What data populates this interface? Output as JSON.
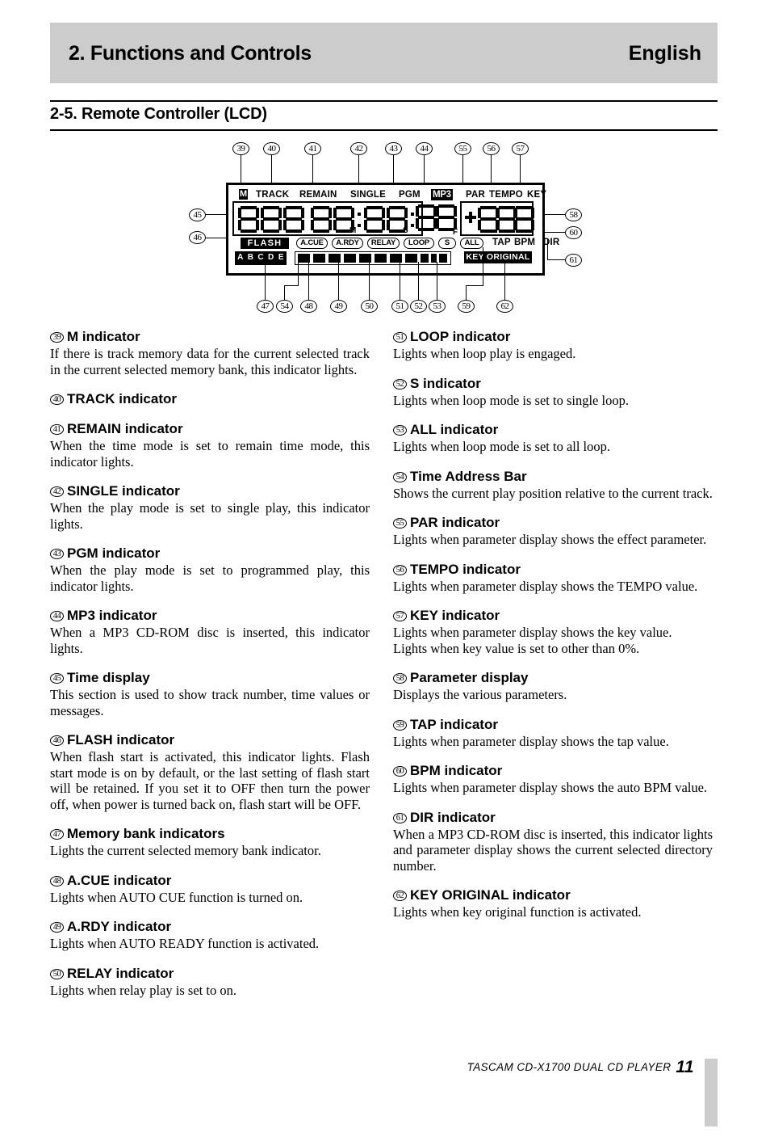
{
  "header": {
    "title": "2. Functions and Controls",
    "language": "English"
  },
  "section": {
    "title": "2-5. Remote Controller (LCD)"
  },
  "figure": {
    "callouts_top": [
      "39",
      "40",
      "41",
      "42",
      "43",
      "44",
      "55",
      "56",
      "57"
    ],
    "callouts_left": [
      "45",
      "46"
    ],
    "callouts_right": [
      "58",
      "60",
      "61"
    ],
    "callouts_bottom": [
      "47",
      "54",
      "48",
      "49",
      "50",
      "51",
      "52",
      "53",
      "59",
      "62"
    ],
    "lcd": {
      "top_indicators": [
        "M",
        "TRACK",
        "REMAIN",
        "SINGLE",
        "PGM",
        "MP3",
        "PAR",
        "TEMPO",
        "KEY"
      ],
      "time_units": [
        "M",
        "S",
        "F"
      ],
      "flash": "FLASH",
      "pills": [
        "A.CUE",
        "A.RDY",
        "RELAY",
        "LOOP",
        "S",
        "ALL"
      ],
      "plain_indicators": [
        "TAP",
        "BPM",
        "DIR"
      ],
      "memory_banks": [
        "A",
        "B",
        "C",
        "D",
        "E"
      ],
      "key_original": "KEY ORIGINAL"
    }
  },
  "left_column": [
    {
      "num": "39",
      "title": "M indicator",
      "body": "If there is track memory data for the current selected track in the current selected memory bank, this indicator lights."
    },
    {
      "num": "40",
      "title": "TRACK indicator",
      "body": ""
    },
    {
      "num": "41",
      "title": "REMAIN indicator",
      "body": "When the time mode is set to remain time mode, this indicator lights."
    },
    {
      "num": "42",
      "title": "SINGLE indicator",
      "body": "When the play mode is set to single play, this indicator lights."
    },
    {
      "num": "43",
      "title": "PGM indicator",
      "body": "When the play mode is set to programmed play, this indicator lights."
    },
    {
      "num": "44",
      "title": "MP3 indicator",
      "body": "When a  MP3 CD-ROM disc is inserted, this indicator lights."
    },
    {
      "num": "45",
      "title": "Time display",
      "body": "This section is used to show track number, time values or messages."
    },
    {
      "num": "46",
      "title": "FLASH indicator",
      "body": "When flash start is activated, this indicator lights. Flash start mode is on by default, or the last setting of flash start will be retained.  If you set it to OFF then turn the power off, when power is turned back on, flash start will be OFF."
    },
    {
      "num": "47",
      "title": "Memory bank indicators",
      "body": "Lights the current selected memory bank indicator."
    },
    {
      "num": "48",
      "title": "A.CUE indicator",
      "body": "Lights when AUTO CUE function is turned on."
    },
    {
      "num": "49",
      "title": "A.RDY indicator",
      "body": "Lights when AUTO READY function is activated."
    },
    {
      "num": "50",
      "title": "RELAY indicator",
      "body": "Lights when relay play is set to on."
    }
  ],
  "right_column": [
    {
      "num": "51",
      "title": "LOOP indicator",
      "body": "Lights when loop play is engaged."
    },
    {
      "num": "52",
      "title": "S indicator",
      "body": "Lights when loop mode is set to single loop."
    },
    {
      "num": "53",
      "title": "ALL indicator",
      "body": "Lights when loop mode is set to all loop."
    },
    {
      "num": "54",
      "title": "Time Address Bar",
      "body": "Shows the current play position relative to the current track."
    },
    {
      "num": "55",
      "title": "PAR indicator",
      "body": "Lights when parameter display shows the effect parameter."
    },
    {
      "num": "56",
      "title": "TEMPO indicator",
      "body": "Lights when parameter display shows the TEMPO value."
    },
    {
      "num": "57",
      "title": "KEY indicator",
      "body": "Lights when parameter display shows the key value.\nLights when key value is set to other than 0%."
    },
    {
      "num": "58",
      "title": "Parameter display",
      "body": "Displays the various parameters."
    },
    {
      "num": "59",
      "title": "TAP indicator",
      "body": "Lights when parameter display shows the tap value."
    },
    {
      "num": "60",
      "title": "BPM indicator",
      "body": "Lights when parameter display shows the auto BPM value."
    },
    {
      "num": "61",
      "title": "DIR indicator",
      "body": "When a  MP3 CD-ROM disc is inserted, this indicator lights and parameter display shows the current selected directory number."
    },
    {
      "num": "62",
      "title": "KEY ORIGINAL indicator",
      "body": "Lights when key original function is activated."
    }
  ],
  "footer": {
    "text": "TASCAM  CD-X1700  DUAL CD PLAYER",
    "page": "11"
  }
}
